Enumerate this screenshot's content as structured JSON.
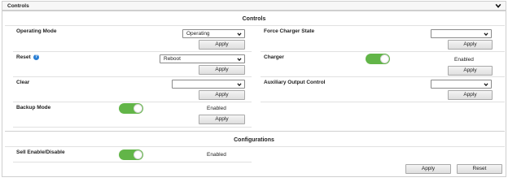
{
  "header": {
    "title": "Controls",
    "chevron_icon": "chevron-down-icon"
  },
  "controls_section": {
    "title": "Controls",
    "operating_mode": {
      "label": "Operating Mode",
      "value": "Operating",
      "apply": "Apply"
    },
    "force_charger_state": {
      "label": "Force Charger State",
      "value": "",
      "apply": "Apply"
    },
    "reset": {
      "label": "Reset",
      "help_icon": "help-icon",
      "value": "Reboot",
      "apply": "Apply"
    },
    "charger": {
      "label": "Charger",
      "status": "Enabled",
      "apply": "Apply"
    },
    "clear": {
      "label": "Clear",
      "value": "",
      "apply": "Apply"
    },
    "auxiliary_output_control": {
      "label": "Auxiliary Output Control",
      "value": "",
      "apply": "Apply"
    },
    "backup_mode": {
      "label": "Backup Mode",
      "status": "Enabled",
      "apply": "Apply"
    }
  },
  "configurations_section": {
    "title": "Configurations",
    "sell_enable": {
      "label": "Sell Enable/Disable",
      "status": "Enabled"
    },
    "apply": "Apply",
    "reset": "Reset"
  },
  "colors": {
    "toggle_on": "#62b548",
    "help_icon": "#2a7fd4",
    "border": "#cfcfcf"
  }
}
